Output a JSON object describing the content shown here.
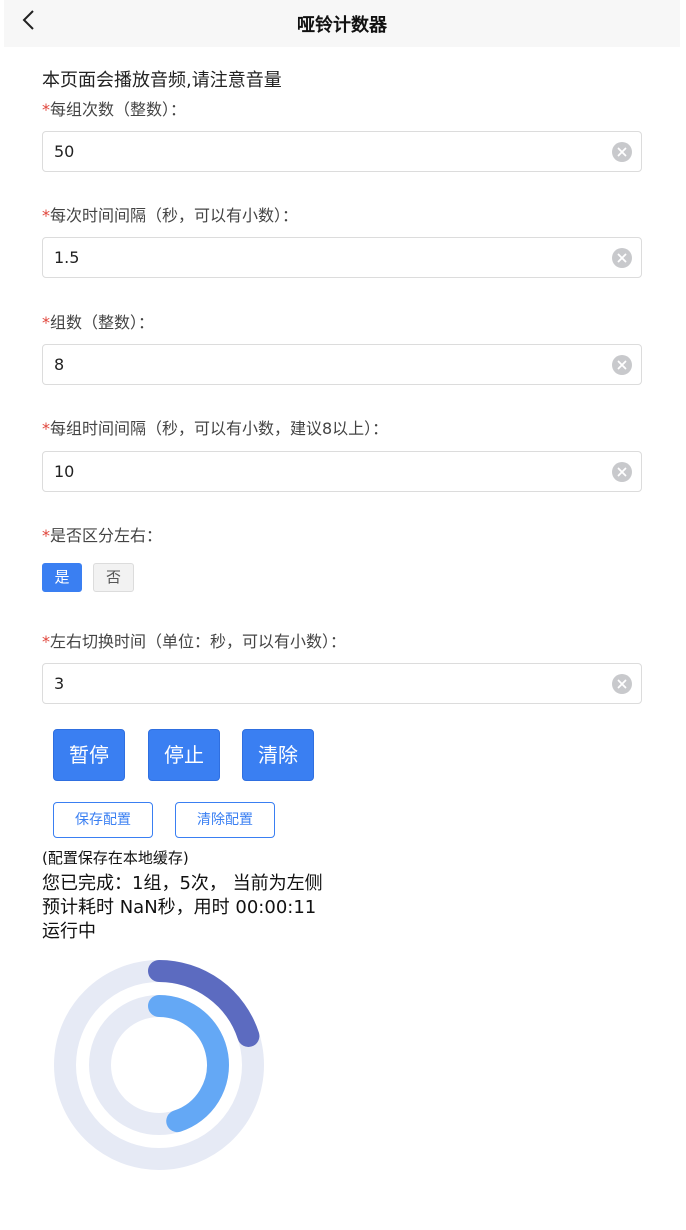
{
  "header": {
    "title": "哑铃计数器",
    "back_icon": "chevron-left-icon"
  },
  "notice": "本页面会播放音频,请注意音量",
  "fields": {
    "reps_per_set": {
      "label": "每组次数（整数）：",
      "value": "50"
    },
    "rep_interval": {
      "label": "每次时间间隔（秒，可以有小数）：",
      "value": "1.5"
    },
    "set_count": {
      "label": "组数（整数）：",
      "value": "8"
    },
    "set_interval": {
      "label": "每组时间间隔（秒，可以有小数，建议8以上）：",
      "value": "10"
    },
    "distinguish_sides": {
      "label": "是否区分左右：",
      "options": [
        "是",
        "否"
      ],
      "selected": "是"
    },
    "side_switch_time": {
      "label": "左右切换时间（单位：秒，可以有小数）：",
      "value": "3"
    }
  },
  "required_marker": "*",
  "actions": {
    "pause": "暂停",
    "stop": "停止",
    "clear": "清除"
  },
  "config": {
    "save": "保存配置",
    "clear": "清除配置",
    "note": "(配置保存在本地缓存)"
  },
  "status": {
    "completed": "您已完成：1组，5次， 当前为左侧",
    "estimate": "预计耗时 NaN秒，用时 00:00:11",
    "state": "运行中"
  },
  "progress": {
    "outer_fraction": 0.2,
    "inner_fraction": 0.45,
    "outer_color": "#5c6bc0",
    "inner_color": "#64a8f5",
    "track_color": "#e6eaf5"
  },
  "colors": {
    "accent": "#3a7ff2",
    "required": "#e0443a"
  }
}
